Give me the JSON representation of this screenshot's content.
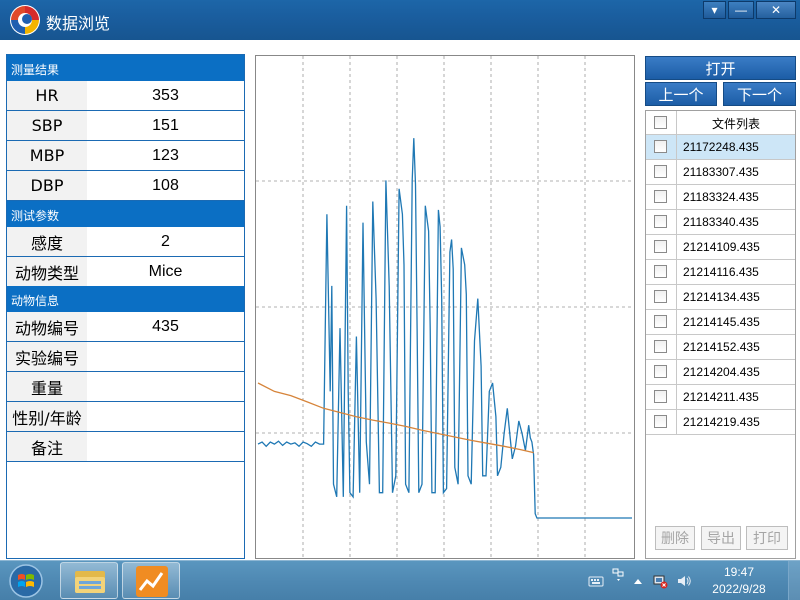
{
  "window": {
    "title": "数据浏览",
    "controls": {
      "dropdown": "▾",
      "minimize": "—",
      "close": "✕"
    }
  },
  "measure_section": {
    "title": "测量结果",
    "rows": [
      {
        "label": "HR",
        "value": "353"
      },
      {
        "label": "SBP",
        "value": "151"
      },
      {
        "label": "MBP",
        "value": "123"
      },
      {
        "label": "DBP",
        "value": "108"
      }
    ]
  },
  "test_section": {
    "title": "测试参数",
    "rows": [
      {
        "label": "感度",
        "value": "2"
      },
      {
        "label": "动物类型",
        "value": "Mice"
      }
    ]
  },
  "animal_section": {
    "title": "动物信息",
    "rows": [
      {
        "label": "动物编号",
        "value": "435"
      },
      {
        "label": "实验编号",
        "value": ""
      },
      {
        "label": "重量",
        "value": ""
      },
      {
        "label": "性别/年龄",
        "value": ""
      },
      {
        "label": "备注",
        "value": ""
      }
    ]
  },
  "right_panel": {
    "open_label": "打开",
    "prev_label": "上一个",
    "next_label": "下一个",
    "list_header": "文件列表",
    "files": [
      "21172248.435",
      "21183307.435",
      "21183324.435",
      "21183340.435",
      "21214109.435",
      "21214116.435",
      "21214134.435",
      "21214145.435",
      "21214152.435",
      "21214204.435",
      "21214211.435",
      "21214219.435"
    ],
    "selected_index": 0,
    "delete_label": "删除",
    "export_label": "导出",
    "print_label": "打印"
  },
  "taskbar": {
    "time": "19:47",
    "date": "2022/9/28"
  },
  "colors": {
    "section_header": "#0b6fc4",
    "pulse_line": "#1f78b4",
    "cuff_line": "#d6843a",
    "grid": "#999999"
  },
  "chart_data": {
    "type": "line",
    "title": "",
    "xlabel": "",
    "ylabel": "",
    "grid": true,
    "series": [
      {
        "values": [
          [
            0,
            0.175
          ],
          [
            2.5,
            0.18
          ],
          [
            5,
            0.17
          ],
          [
            7.5,
            0.18
          ],
          [
            10,
            0.175
          ],
          [
            12.5,
            0.182
          ],
          [
            15,
            0.172
          ],
          [
            17.5,
            0.18
          ],
          [
            20,
            0.175
          ],
          [
            22.5,
            0.178
          ],
          [
            25,
            0.17
          ],
          [
            27.5,
            0.18
          ],
          [
            30,
            0.176
          ],
          [
            32.5,
            0.17
          ],
          [
            35,
            0.18
          ],
          [
            37.5,
            0.175
          ],
          [
            40,
            0.175
          ],
          [
            42,
            0.72
          ],
          [
            44,
            0.3
          ],
          [
            45,
            0.55
          ],
          [
            46,
            0.08
          ],
          [
            48,
            0.05
          ],
          [
            50,
            0.45
          ],
          [
            52,
            0.05
          ],
          [
            54,
            0.74
          ],
          [
            55,
            0.3
          ],
          [
            56,
            0.06
          ],
          [
            58,
            0.05
          ],
          [
            60,
            0.43
          ],
          [
            62,
            0.06
          ],
          [
            64,
            0.7
          ],
          [
            66,
            0.18
          ],
          [
            68,
            0.08
          ],
          [
            70,
            0.75
          ],
          [
            72,
            0.52
          ],
          [
            74,
            0.06
          ],
          [
            76,
            0.06
          ],
          [
            78,
            0.8
          ],
          [
            80,
            0.55
          ],
          [
            82,
            0.06
          ],
          [
            84,
            0.1
          ],
          [
            86,
            0.78
          ],
          [
            88,
            0.72
          ],
          [
            89,
            0.6
          ],
          [
            90,
            0.08
          ],
          [
            92,
            0.06
          ],
          [
            94,
            0.8
          ],
          [
            95,
            0.9
          ],
          [
            96,
            0.79
          ],
          [
            97,
            0.45
          ],
          [
            98,
            0.06
          ],
          [
            100,
            0.08
          ],
          [
            102,
            0.74
          ],
          [
            104,
            0.68
          ],
          [
            105,
            0.45
          ],
          [
            106,
            0.06
          ],
          [
            108,
            0.06
          ],
          [
            110,
            0.73
          ],
          [
            111,
            0.69
          ],
          [
            112,
            0.52
          ],
          [
            113,
            0.06
          ],
          [
            115,
            0.07
          ],
          [
            117,
            0.63
          ],
          [
            118,
            0.66
          ],
          [
            119,
            0.59
          ],
          [
            120,
            0.12
          ],
          [
            122,
            0.08
          ],
          [
            124,
            0.64
          ],
          [
            126,
            0.6
          ],
          [
            127,
            0.53
          ],
          [
            128,
            0.1
          ],
          [
            130,
            0.08
          ],
          [
            132,
            0.42
          ],
          [
            134,
            0.52
          ],
          [
            136,
            0.36
          ],
          [
            137,
            0.1
          ],
          [
            139,
            0.1
          ],
          [
            141,
            0.3
          ],
          [
            143,
            0.32
          ],
          [
            145,
            0.24
          ],
          [
            146,
            0.1
          ],
          [
            148,
            0.12
          ],
          [
            150,
            0.2
          ],
          [
            152,
            0.26
          ],
          [
            154,
            0.18
          ],
          [
            155,
            0.14
          ],
          [
            157,
            0.17
          ],
          [
            159,
            0.23
          ],
          [
            161,
            0.2
          ],
          [
            163,
            0.16
          ],
          [
            165,
            0.22
          ],
          [
            166,
            0.19
          ],
          [
            167,
            0.18
          ],
          [
            168,
            0.15
          ],
          [
            169,
            0.01
          ],
          [
            170,
            0.0
          ],
          [
            190,
            0.0
          ],
          [
            228,
            0.0
          ]
        ]
      },
      {
        "values": [
          [
            0,
            0.32
          ],
          [
            10,
            0.3
          ],
          [
            20,
            0.29
          ],
          [
            30,
            0.275
          ],
          [
            40,
            0.26
          ],
          [
            50,
            0.25
          ],
          [
            60,
            0.24
          ],
          [
            70,
            0.232
          ],
          [
            80,
            0.225
          ],
          [
            90,
            0.217
          ],
          [
            100,
            0.208
          ],
          [
            110,
            0.2
          ],
          [
            120,
            0.192
          ],
          [
            130,
            0.184
          ],
          [
            140,
            0.177
          ],
          [
            150,
            0.17
          ],
          [
            160,
            0.162
          ],
          [
            168,
            0.155
          ]
        ]
      }
    ]
  }
}
